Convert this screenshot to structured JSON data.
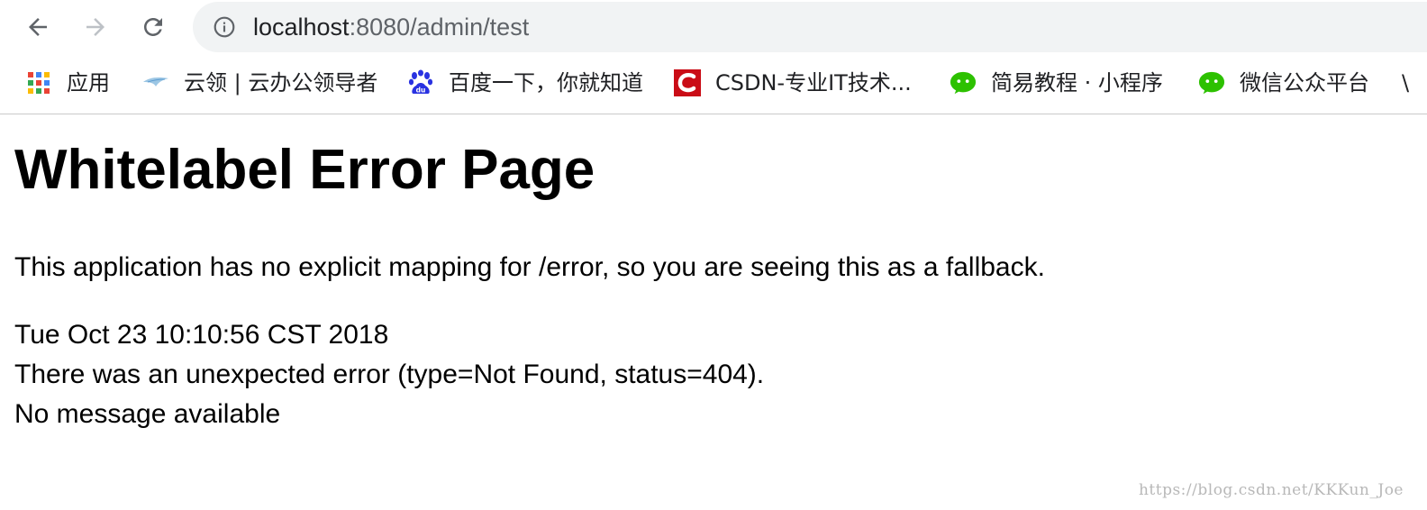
{
  "browser": {
    "url_host": "localhost",
    "url_rest": ":8080/admin/test"
  },
  "bookmarks": [
    {
      "label": "应用",
      "icon": "apps-grid-icon"
    },
    {
      "label": "云领 | 云办公领导者",
      "icon": "yunling-bird-icon"
    },
    {
      "label": "百度一下，你就知道",
      "icon": "baidu-paw-icon"
    },
    {
      "label": "CSDN-专业IT技术...",
      "icon": "csdn-icon"
    },
    {
      "label": "简易教程 · 小程序",
      "icon": "wechat-icon"
    },
    {
      "label": "微信公众平台",
      "icon": "wechat-icon"
    }
  ],
  "page": {
    "title": "Whitelabel Error Page",
    "description": "This application has no explicit mapping for /error, so you are seeing this as a fallback.",
    "timestamp": "Tue Oct 23 10:10:56 CST 2018",
    "error": "There was an unexpected error (type=Not Found, status=404).",
    "message": "No message available"
  },
  "watermark": "https://blog.csdn.net/KKKun_Joe",
  "colors": {
    "omnibox_bg": "#f1f3f4",
    "csdn_red": "#ca0c16",
    "wechat_green": "#2dc100",
    "baidu_blue": "#2932e1"
  }
}
